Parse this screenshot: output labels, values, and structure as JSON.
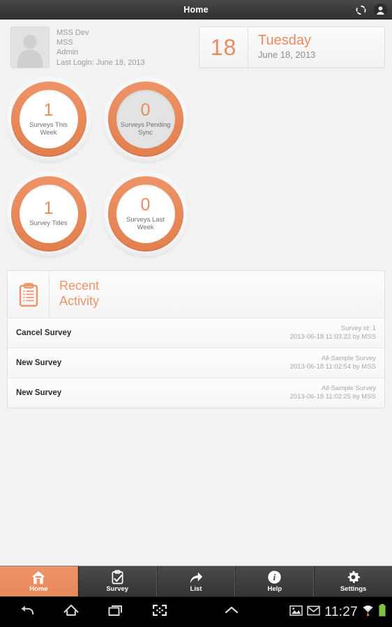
{
  "header": {
    "title": "Home",
    "sync_icon": "sync-icon",
    "account_icon": "account-icon"
  },
  "profile": {
    "avatar_icon": "user-avatar-placeholder",
    "name": "MSS Dev",
    "org": "MSS",
    "role": "Admin",
    "last_login": "Last Login: June 18, 2013"
  },
  "date_card": {
    "day_number": "18",
    "weekday": "Tuesday",
    "full_date": "June 18, 2013"
  },
  "stats": [
    {
      "value": "1",
      "label": "Surveys This Week",
      "dim": false
    },
    {
      "value": "0",
      "label": "Surveys Pending Sync",
      "dim": true
    },
    {
      "value": "1",
      "label": "Survey Titles",
      "dim": false
    },
    {
      "value": "0",
      "label": "Surveys Last Week",
      "dim": false
    }
  ],
  "activity": {
    "icon": "clipboard-icon",
    "title_line1": "Recent",
    "title_line2": "Activity",
    "rows": [
      {
        "name": "Cancel Survey",
        "detail": "Survey id: 1",
        "timestamp": "2013-06-18 11:03:22 by MSS"
      },
      {
        "name": "New Survey",
        "detail": "All-Sample Survey",
        "timestamp": "2013-06-18 11:02:54 by MSS"
      },
      {
        "name": "New Survey",
        "detail": "All-Sample Survey",
        "timestamp": "2013-06-18 11:02:25 by MSS"
      }
    ]
  },
  "tabs": [
    {
      "label": "Home",
      "icon": "home-icon",
      "active": true
    },
    {
      "label": "Survey",
      "icon": "clipboard-check-icon",
      "active": false
    },
    {
      "label": "List",
      "icon": "share-arrow-icon",
      "active": false
    },
    {
      "label": "Help",
      "icon": "info-icon",
      "active": false
    },
    {
      "label": "Settings",
      "icon": "gear-icon",
      "active": false
    }
  ],
  "system_bar": {
    "back_icon": "back-icon",
    "home_icon": "home-outline-icon",
    "recents_icon": "recent-apps-icon",
    "screenshot_icon": "screenshot-icon",
    "expand_icon": "chevron-up-icon",
    "image_icon": "image-icon",
    "mail_icon": "mail-icon",
    "clock": "11:27",
    "wifi_icon": "wifi-icon",
    "battery_icon": "battery-full-icon"
  },
  "colors": {
    "accent": "#EA8B5E",
    "accent_dark": "#E27F4E",
    "background": "#F2F2F2",
    "header_bar": "#3A3A3A",
    "battery_green": "#7DC242"
  }
}
